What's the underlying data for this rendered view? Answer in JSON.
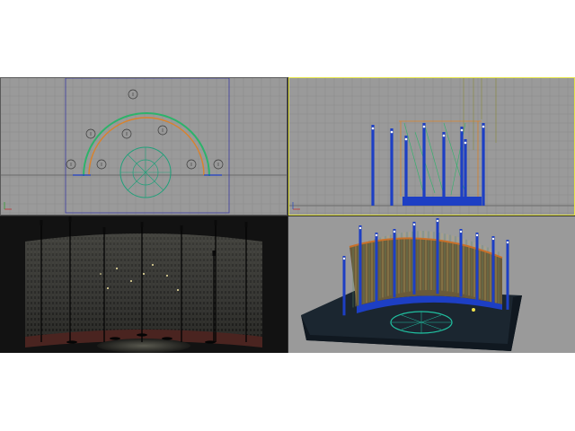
{
  "viewports": [
    {
      "id": "top",
      "kind": "orthographic-top",
      "grid": true,
      "active": false
    },
    {
      "id": "front",
      "kind": "orthographic-front",
      "grid": true,
      "active": true
    },
    {
      "id": "camera",
      "kind": "rendered-camera",
      "grid": false,
      "active": false
    },
    {
      "id": "perspective",
      "kind": "shaded-perspective",
      "grid": false,
      "active": false
    }
  ],
  "colors": {
    "viewport_bg": "#9a9a9a",
    "grid_line": "#888888",
    "spline_green": "#2db36a",
    "spline_orange": "#d9822b",
    "column_blue": "#1d3fc4",
    "light_yellow": "#f0e24a",
    "active_border": "#e6e64a",
    "render_bg": "#1a1a1a",
    "floor_dark": "#1b2630"
  },
  "icons": [
    "axis-gizmo-icon",
    "omni-light-icon",
    "spotlight-icon"
  ]
}
